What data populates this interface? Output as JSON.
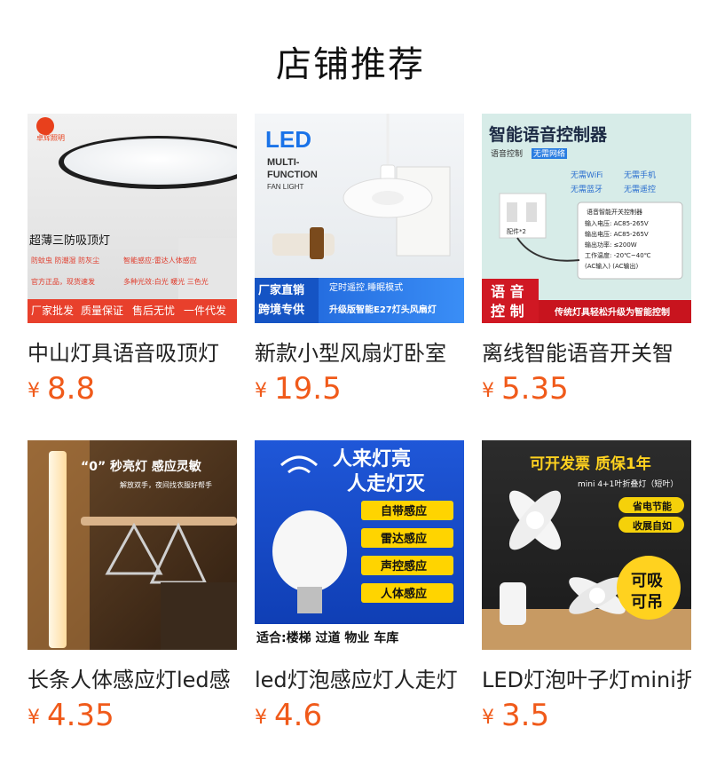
{
  "section": {
    "title": "店铺推荐"
  },
  "currency": "¥",
  "products": [
    {
      "name": "中山灯具语音吸顶灯",
      "price": "8.8",
      "image": {
        "brand": "卓辉照明",
        "headline": "超薄三防吸顶灯",
        "features": [
          "防蚊虫 防潮湿 防灰尘",
          "智能感应:雷达人体感应",
          "官方正品，现货速发",
          "多种光效:白光 暖光 三色光"
        ],
        "banner": [
          "厂家批发",
          "质量保证",
          "售后无忧",
          "一件代发"
        ]
      }
    },
    {
      "name": "新款小型风扇灯卧室",
      "price": "19.5",
      "image": {
        "big": "LED",
        "line1": "MULTI-",
        "line2": "FUNCTION",
        "line3": "FAN LIGHT",
        "badge1": "厂家直销",
        "badge2": "跨境专供",
        "note": "定时遥控.睡眠模式",
        "bottom": "升级版智能E27灯头风扇灯"
      }
    },
    {
      "name": "离线智能语音开关智",
      "price": "5.35",
      "image": {
        "headline": "智能语音控制器",
        "tag1": "语音控制",
        "tag2": "无需网络",
        "checks": [
          "无需WiFi",
          "无需手机",
          "无需蓝牙",
          "无需遥控"
        ],
        "accessory": "配件*2",
        "spec_title": "语音智能开关控制器",
        "specs": [
          "输入电压: AC85-265V",
          "输出电压: AC85-265V",
          "输出功率: ≤200W",
          "工作温度: -20℃~40℃",
          "(AC输入)  (AC输出)"
        ],
        "corner": "语音控制",
        "bottom": "传统灯具轻松升级为智能控制"
      }
    },
    {
      "name": "长条人体感应灯led感",
      "price": "4.35",
      "image": {
        "headline": "“0” 秒亮灯  感应灵敏",
        "sub": "解放双手，夜间找衣服好帮手"
      }
    },
    {
      "name": "led灯泡感应灯人走灯",
      "price": "4.6",
      "image": {
        "line1": "人来灯亮",
        "line2": "人走灯灭",
        "features": [
          "自带感应",
          "雷达感应",
          "声控感应",
          "人体感应"
        ],
        "bottom": "适合:楼梯 过道 物业 车库"
      }
    },
    {
      "name": "LED灯泡叶子灯mini折",
      "price": "3.5",
      "image": {
        "headline": "可开发票  质保1年",
        "sub": "mini 4+1叶折叠灯（短叶）",
        "pills": [
          "省电节能",
          "收展自如"
        ],
        "badge1": "可吸",
        "badge2": "可吊"
      }
    }
  ]
}
